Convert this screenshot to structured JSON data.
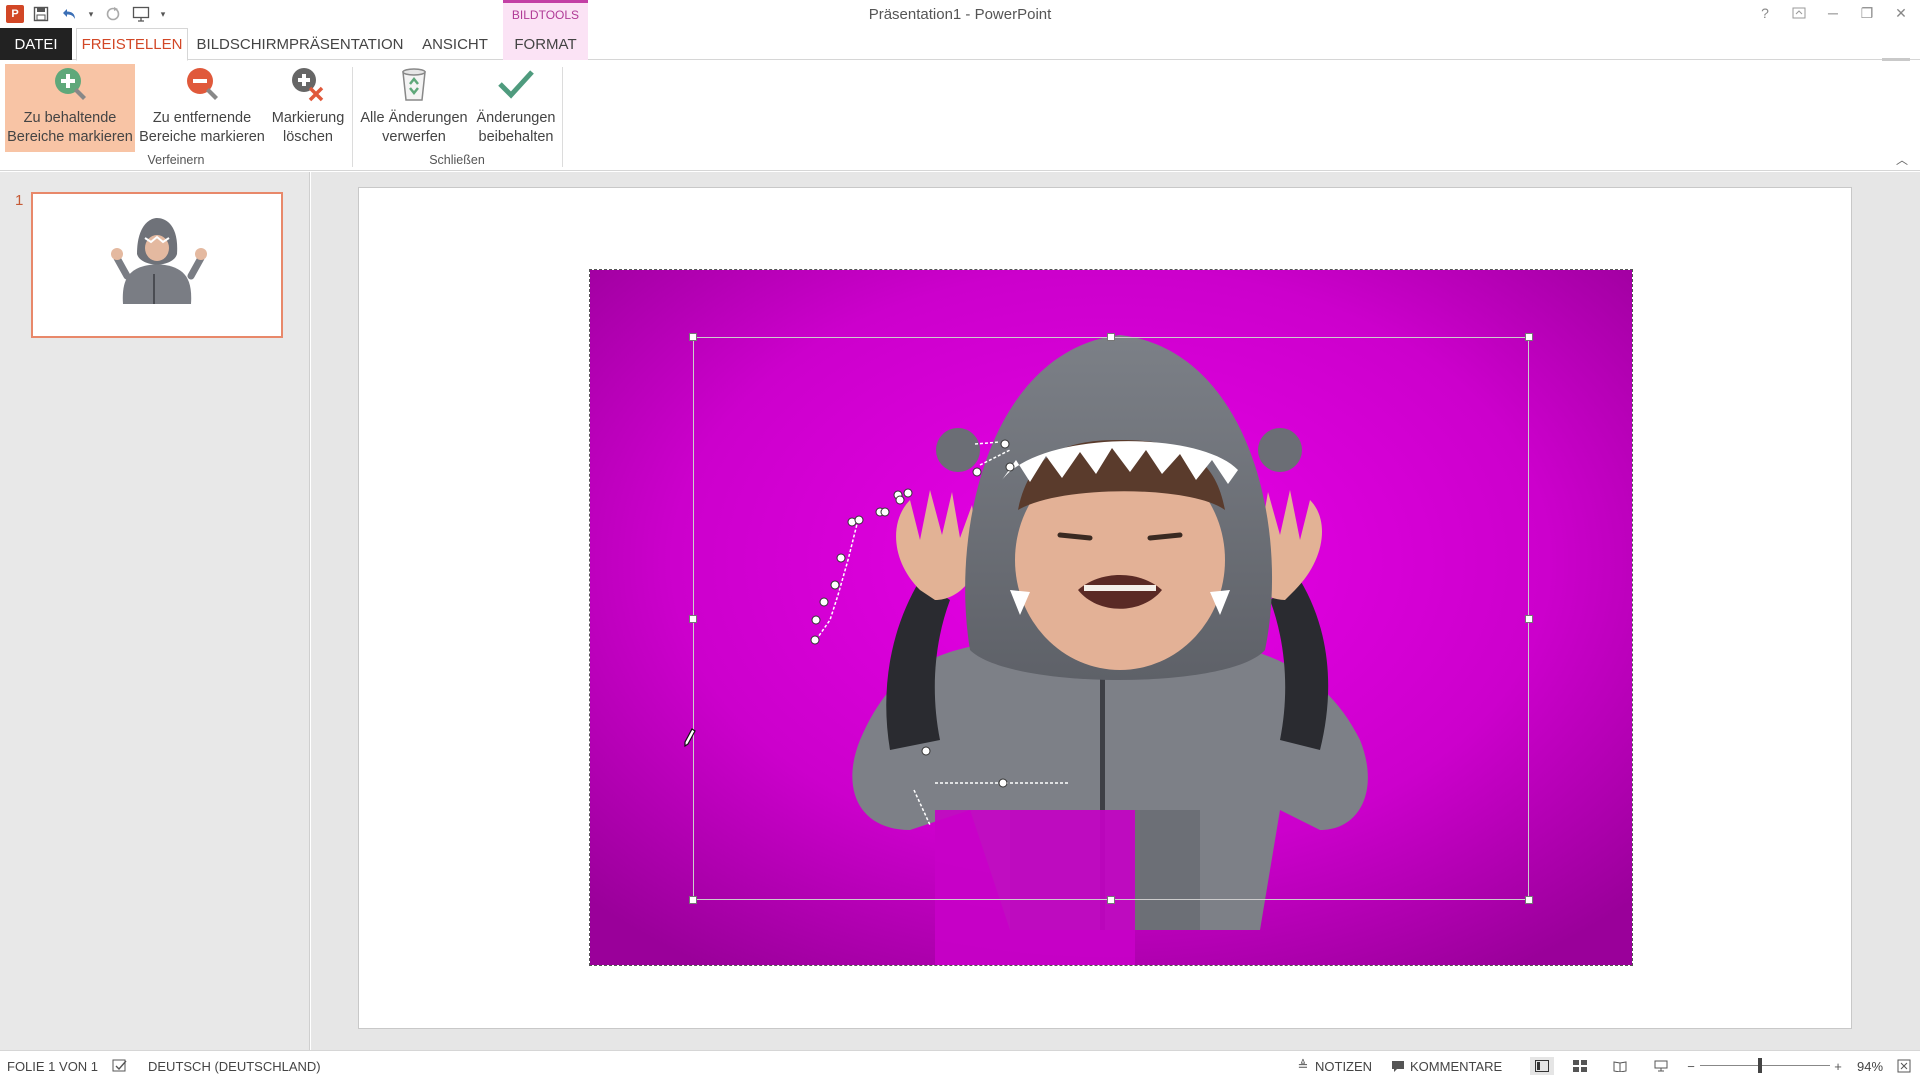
{
  "window": {
    "title": "Präsentation1 - PowerPoint",
    "contextual_group": "BILDTOOLS"
  },
  "tabs": {
    "file": "DATEI",
    "active": "FREISTELLEN",
    "slideshow": "BILDSCHIRMPRÄSENTATION",
    "view": "ANSICHT",
    "format": "FORMAT"
  },
  "ribbon": {
    "keep": {
      "line1": "Zu behaltende",
      "line2": "Bereiche markieren"
    },
    "remove": {
      "line1": "Zu entfernende",
      "line2": "Bereiche markieren"
    },
    "delete": {
      "line1": "Markierung",
      "line2": "löschen"
    },
    "discard": {
      "line1": "Alle Änderungen",
      "line2": "verwerfen"
    },
    "keep_changes": {
      "line1": "Änderungen",
      "line2": "beibehalten"
    },
    "group_refine": "Verfeinern",
    "group_close": "Schließen"
  },
  "slides": {
    "number": "1"
  },
  "status": {
    "slide": "FOLIE 1 VON 1",
    "language": "DEUTSCH (DEUTSCHLAND)",
    "notes": "NOTIZEN",
    "comments": "KOMMENTARE",
    "zoom": "94%"
  },
  "colors": {
    "accent": "#d24726",
    "removal_overlay": "#d600d6",
    "selected_button": "#f8c4a5"
  }
}
